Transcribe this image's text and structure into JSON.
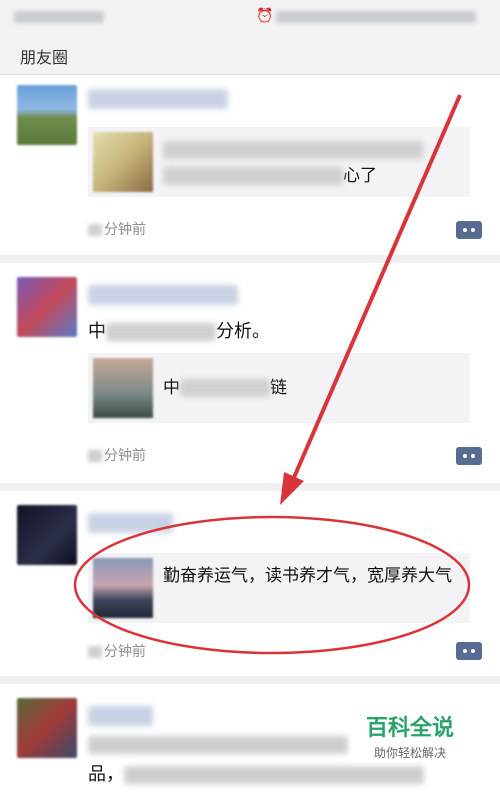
{
  "header": {
    "title": "朋友圈"
  },
  "posts": [
    {
      "link_title_end": "心了",
      "time_suffix": "分钟前"
    },
    {
      "text_start": "中",
      "text_end": "分析。",
      "link_start": "中",
      "link_end": "链",
      "time_suffix": "分钟前"
    },
    {
      "link_title": "勤奋养运气，读书养才气，宽厚养大气",
      "time_suffix": "分钟前"
    },
    {
      "text_line2_start": "品，"
    }
  ],
  "watermark": {
    "main": "百科全说",
    "sub": "助你轻松解决"
  },
  "colors": {
    "annotation": "#d9343a",
    "comment_btn": "#586b93",
    "watermark": "#2aa36b"
  },
  "icons": [
    "alarm-icon",
    "signal-icon",
    "battery-icon",
    "comment-icon",
    "arrow-annotation"
  ]
}
